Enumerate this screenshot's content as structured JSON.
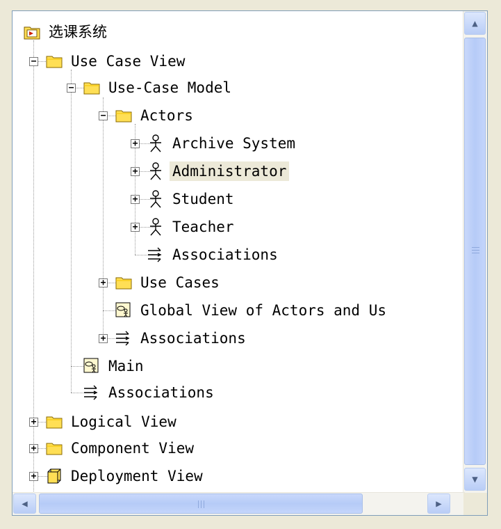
{
  "tree": {
    "root": "选课系统",
    "nodes": [
      {
        "label": "Use Case View"
      },
      {
        "label": "Use-Case Model"
      },
      {
        "label": "Actors"
      },
      {
        "label": "Archive System"
      },
      {
        "label": "Administrator",
        "selected": true
      },
      {
        "label": "Student"
      },
      {
        "label": "Teacher"
      },
      {
        "label": "Associations"
      },
      {
        "label": "Use Cases"
      },
      {
        "label": "Global View of Actors and Us"
      },
      {
        "label": "Associations"
      },
      {
        "label": "Main"
      },
      {
        "label": "Associations"
      },
      {
        "label": "Logical View"
      },
      {
        "label": "Component View"
      },
      {
        "label": "Deployment View"
      }
    ]
  },
  "icons": {
    "root": "model-folder-icon",
    "folder": "folder-icon",
    "actor": "actor-icon",
    "associations": "associations-icon",
    "diagram": "use-case-diagram-icon",
    "package": "package-icon"
  },
  "scrollbars": {
    "vertical": {
      "up": "▲",
      "down": "▼"
    },
    "horizontal": {
      "left": "◀",
      "right": "▶"
    }
  },
  "colors": {
    "folder": "#ffdf55",
    "selection": "#ece9d8",
    "scrollbar": "#c1d3fb",
    "tree_lines": "#9a9a9a"
  }
}
